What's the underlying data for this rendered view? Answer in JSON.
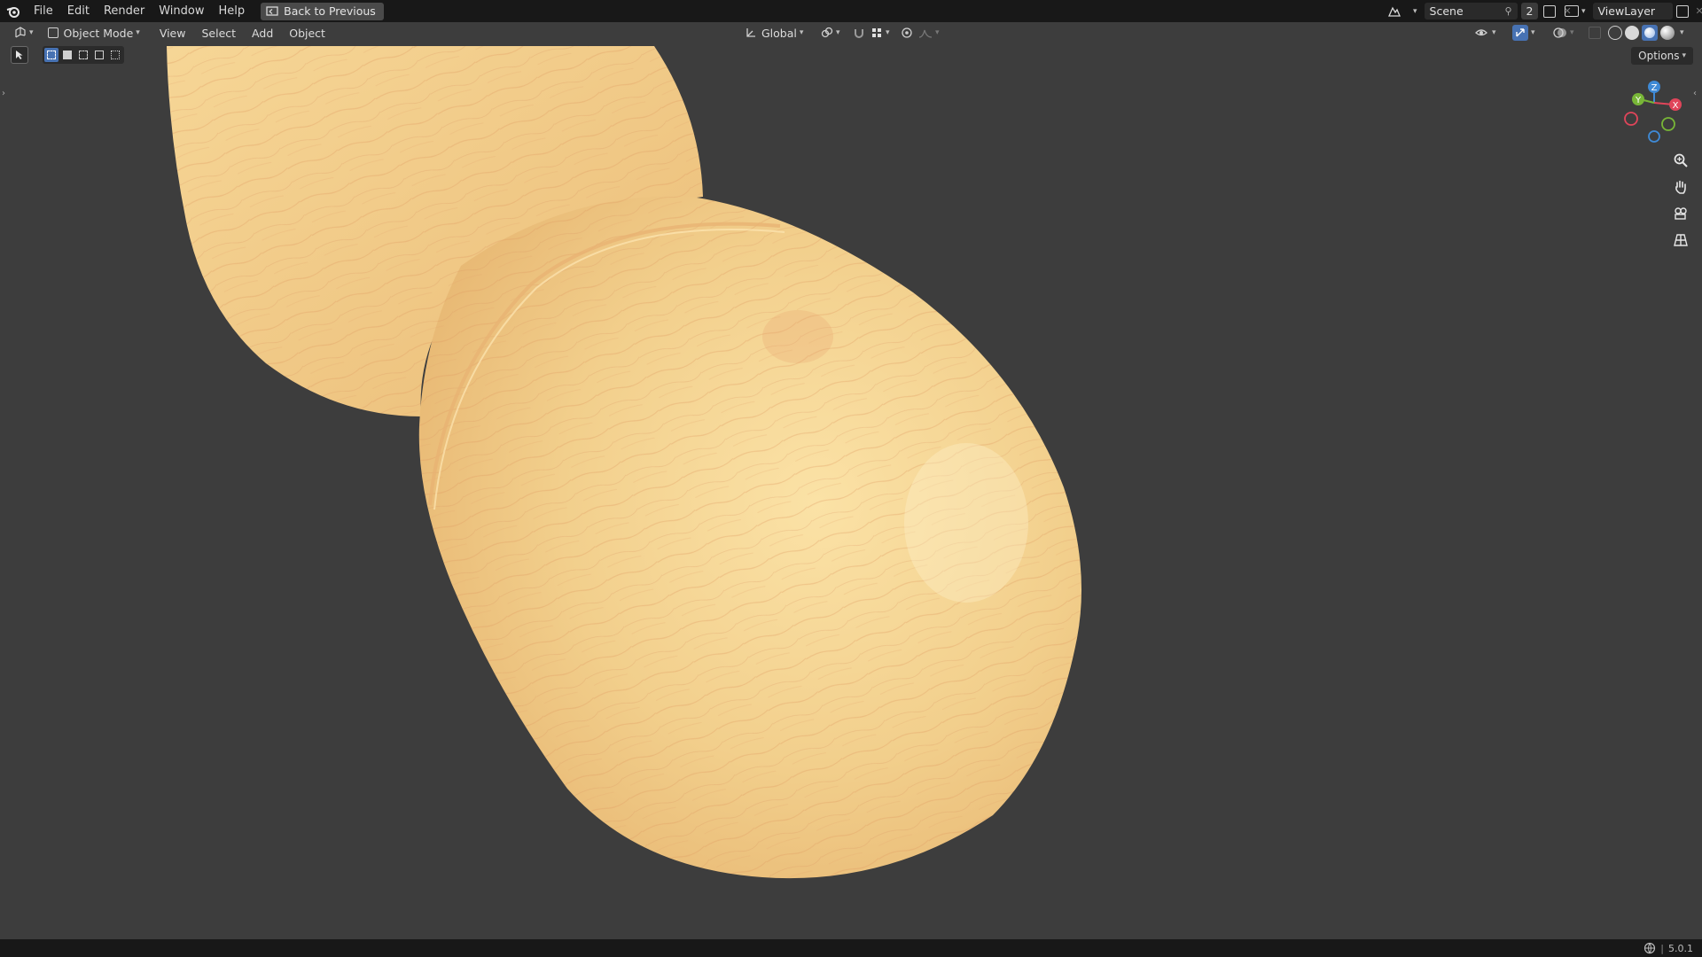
{
  "menu": {
    "items": [
      "File",
      "Edit",
      "Render",
      "Window",
      "Help"
    ],
    "back_label": "Back to Previous"
  },
  "scene": {
    "name": "Scene",
    "users": "2"
  },
  "view_layer": {
    "name": "ViewLayer"
  },
  "viewport_header": {
    "mode": "Object Mode",
    "menus": [
      "View",
      "Select",
      "Add",
      "Object"
    ],
    "orientation": "Global"
  },
  "options_label": "Options",
  "gizmo": {
    "x": "X",
    "y": "Y",
    "z": "Z"
  },
  "status": {
    "version": "5.0.1"
  },
  "colors": {
    "background": "#3d3d3d",
    "bar": "#181818",
    "wood_light": "#f3d390",
    "wood_dark": "#e0a96a",
    "axis_x": "#e0455a",
    "axis_y": "#78b637",
    "axis_z": "#3f8ad6"
  }
}
